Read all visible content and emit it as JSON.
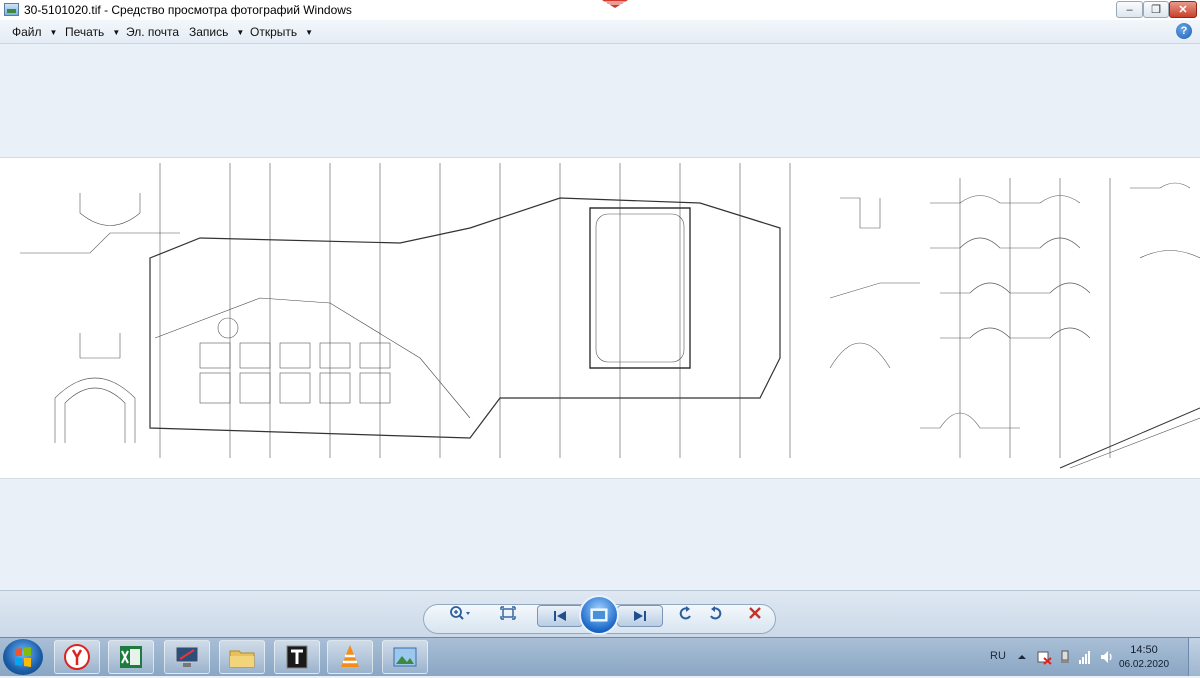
{
  "window": {
    "title": "30-5101020.tif - Средство просмотра фотографий Windows",
    "min_label": "–",
    "max_label": "❐",
    "close_label": "✕"
  },
  "menu": {
    "items": [
      "Файл",
      "Печать",
      "Эл. почта",
      "Запись",
      "Открыть"
    ],
    "help_label": "?"
  },
  "image": {
    "content": "engineering drawing",
    "icon": "blueprint-drawing"
  },
  "controls": {
    "zoom_icon": "zoom-icon",
    "fit_icon": "actual-size-icon",
    "prev_icon": "previous-icon",
    "slideshow_icon": "slideshow-icon",
    "next_icon": "next-icon",
    "rotate_ccw_icon": "rotate-counterclockwise-icon",
    "rotate_cw_icon": "rotate-clockwise-icon",
    "delete_icon": "delete-icon"
  },
  "taskbar": {
    "apps": [
      "yandex-browser-icon",
      "excel-icon",
      "display-settings-icon",
      "file-explorer-icon",
      "total-commander-icon",
      "vlc-icon",
      "photo-viewer-icon"
    ],
    "lang": "RU",
    "time": "14:50",
    "date": "06.02.2020"
  },
  "colors": {
    "accent": "#1d5fb3",
    "close": "#c8412b",
    "delete": "#c8302a"
  }
}
